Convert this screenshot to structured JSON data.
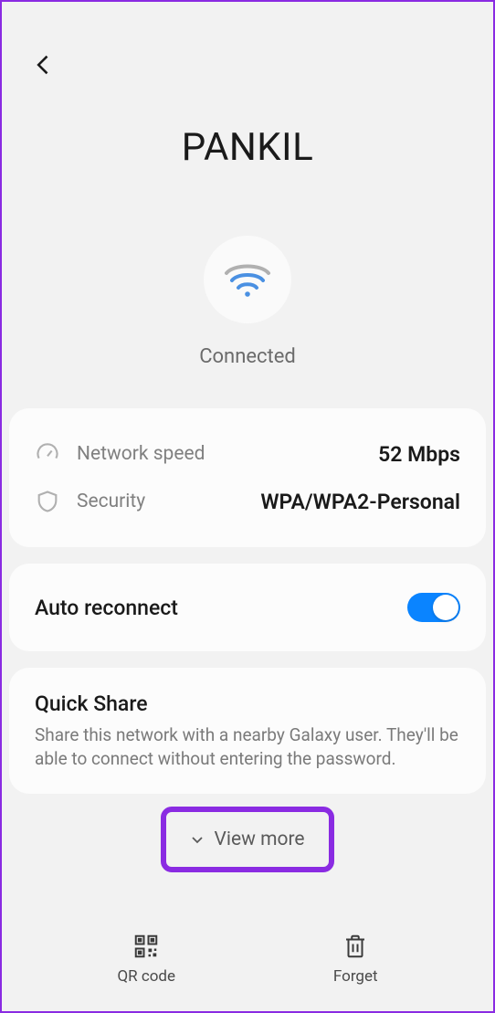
{
  "network_name": "PANKIL",
  "status": "Connected",
  "stats": {
    "speed": {
      "label": "Network speed",
      "value": "52 Mbps"
    },
    "security": {
      "label": "Security",
      "value": "WPA/WPA2-Personal"
    }
  },
  "auto_reconnect": {
    "label": "Auto reconnect",
    "enabled": true
  },
  "quick_share": {
    "title": "Quick Share",
    "description": "Share this network with a nearby Galaxy user. They'll be able to connect without entering the password."
  },
  "view_more": "View more",
  "bottom": {
    "qr": "QR code",
    "forget": "Forget"
  }
}
